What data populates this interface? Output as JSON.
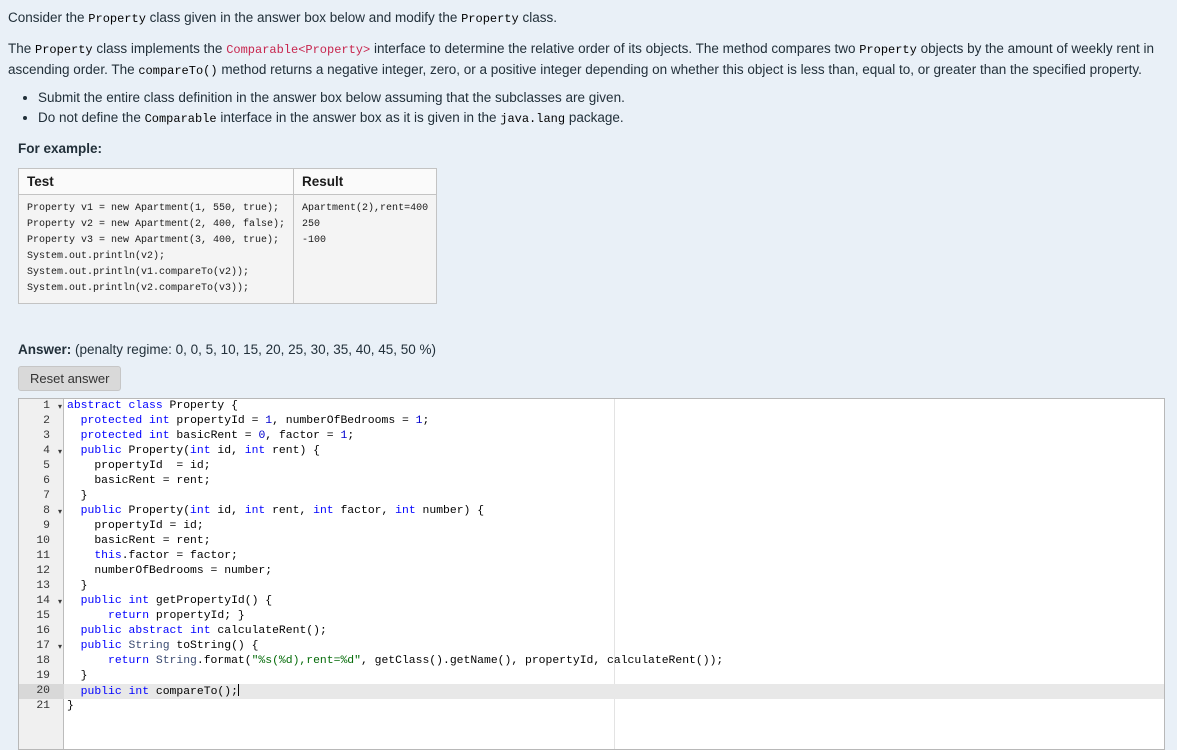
{
  "question": {
    "para1": [
      {
        "t": "text",
        "s": "Consider the "
      },
      {
        "t": "code",
        "s": "Property"
      },
      {
        "t": "text",
        "s": " class given in the answer box below and modify the "
      },
      {
        "t": "code",
        "s": "Property"
      },
      {
        "t": "text",
        "s": " class."
      }
    ],
    "para2": [
      {
        "t": "text",
        "s": "The "
      },
      {
        "t": "code",
        "s": "Property"
      },
      {
        "t": "text",
        "s": " class implements the "
      },
      {
        "t": "code_pink",
        "s": "Comparable<Property>"
      },
      {
        "t": "text",
        "s": " interface to determine the relative order of its objects. The method compares two "
      },
      {
        "t": "code",
        "s": "Property"
      },
      {
        "t": "text",
        "s": " objects by the amount of weekly rent in ascending order. The "
      },
      {
        "t": "code",
        "s": "compareTo()"
      },
      {
        "t": "text",
        "s": " method returns a negative integer, zero, or a positive integer depending on whether this object is less than, equal to, or greater than the specified property."
      }
    ],
    "bullets": [
      [
        {
          "t": "text",
          "s": "Submit the entire class definition in the answer box below assuming that the subclasses are given."
        }
      ],
      [
        {
          "t": "text",
          "s": "Do not define the "
        },
        {
          "t": "code",
          "s": "Comparable"
        },
        {
          "t": "text",
          "s": " interface in the answer box as it is given in the "
        },
        {
          "t": "code",
          "s": "java.lang"
        },
        {
          "t": "text",
          "s": " package."
        }
      ]
    ],
    "for_example_label": "For example:"
  },
  "example_table": {
    "test_header": "Test",
    "result_header": "Result",
    "test_code": "Property v1 = new Apartment(1, 550, true);\nProperty v2 = new Apartment(2, 400, false);\nProperty v3 = new Apartment(3, 400, true);\nSystem.out.println(v2);\nSystem.out.println(v1.compareTo(v2));\nSystem.out.println(v2.compareTo(v3));",
    "result_code": "Apartment(2),rent=400\n250\n-100"
  },
  "answer_section": {
    "label": "Answer:",
    "penalty_text": "(penalty regime: 0, 0, 5, 10, 15, 20, 25, 30, 35, 40, 45, 50 %)",
    "reset_button_label": "Reset answer"
  },
  "editor": {
    "active_line": 20,
    "fold_lines": [
      1,
      4,
      8,
      14,
      17
    ],
    "colors": {
      "keyword": "#0000ff",
      "number": "#0000cd",
      "string": "#036a07",
      "support_class": "#3c4c72",
      "plain": "#000000",
      "active_line_bg": "#e8e8e8",
      "gutter_bg": "#f0f0f0"
    },
    "lines": [
      [
        [
          "kw",
          "abstract"
        ],
        [
          "t",
          " "
        ],
        [
          "kw",
          "class"
        ],
        [
          "t",
          " Property {"
        ]
      ],
      [
        [
          "t",
          "  "
        ],
        [
          "kw",
          "protected"
        ],
        [
          "t",
          " "
        ],
        [
          "kw",
          "int"
        ],
        [
          "t",
          " propertyId = "
        ],
        [
          "num",
          "1"
        ],
        [
          "t",
          ", numberOfBedrooms = "
        ],
        [
          "num",
          "1"
        ],
        [
          "t",
          ";"
        ]
      ],
      [
        [
          "t",
          "  "
        ],
        [
          "kw",
          "protected"
        ],
        [
          "t",
          " "
        ],
        [
          "kw",
          "int"
        ],
        [
          "t",
          " basicRent = "
        ],
        [
          "num",
          "0"
        ],
        [
          "t",
          ", factor = "
        ],
        [
          "num",
          "1"
        ],
        [
          "t",
          ";"
        ]
      ],
      [
        [
          "t",
          "  "
        ],
        [
          "kw",
          "public"
        ],
        [
          "t",
          " Property("
        ],
        [
          "kw",
          "int"
        ],
        [
          "t",
          " id, "
        ],
        [
          "kw",
          "int"
        ],
        [
          "t",
          " rent) {"
        ]
      ],
      [
        [
          "t",
          "    propertyId  = id;"
        ]
      ],
      [
        [
          "t",
          "    basicRent = rent;"
        ]
      ],
      [
        [
          "t",
          "  }"
        ]
      ],
      [
        [
          "t",
          "  "
        ],
        [
          "kw",
          "public"
        ],
        [
          "t",
          " Property("
        ],
        [
          "kw",
          "int"
        ],
        [
          "t",
          " id, "
        ],
        [
          "kw",
          "int"
        ],
        [
          "t",
          " rent, "
        ],
        [
          "kw",
          "int"
        ],
        [
          "t",
          " factor, "
        ],
        [
          "kw",
          "int"
        ],
        [
          "t",
          " number) {"
        ]
      ],
      [
        [
          "t",
          "    propertyId = id;"
        ]
      ],
      [
        [
          "t",
          "    basicRent = rent;"
        ]
      ],
      [
        [
          "t",
          "    "
        ],
        [
          "kw",
          "this"
        ],
        [
          "t",
          ".factor = factor;"
        ]
      ],
      [
        [
          "t",
          "    numberOfBedrooms = number;"
        ]
      ],
      [
        [
          "t",
          "  }"
        ]
      ],
      [
        [
          "t",
          "  "
        ],
        [
          "kw",
          "public"
        ],
        [
          "t",
          " "
        ],
        [
          "kw",
          "int"
        ],
        [
          "t",
          " getPropertyId() {"
        ]
      ],
      [
        [
          "t",
          "      "
        ],
        [
          "kw",
          "return"
        ],
        [
          "t",
          " propertyId; }"
        ]
      ],
      [
        [
          "t",
          "  "
        ],
        [
          "kw",
          "public"
        ],
        [
          "t",
          " "
        ],
        [
          "kw",
          "abstract"
        ],
        [
          "t",
          " "
        ],
        [
          "kw",
          "int"
        ],
        [
          "t",
          " calculateRent();"
        ]
      ],
      [
        [
          "t",
          "  "
        ],
        [
          "kw",
          "public"
        ],
        [
          "t",
          " "
        ],
        [
          "sup",
          "String"
        ],
        [
          "t",
          " toString() {"
        ]
      ],
      [
        [
          "t",
          "      "
        ],
        [
          "kw",
          "return"
        ],
        [
          "t",
          " "
        ],
        [
          "sup",
          "String"
        ],
        [
          "t",
          ".format("
        ],
        [
          "str",
          "\"%s(%d),rent=%d\""
        ],
        [
          "t",
          ", getClass().getName(), propertyId, calculateRent());"
        ]
      ],
      [
        [
          "t",
          "  }"
        ]
      ],
      [
        [
          "t",
          "  "
        ],
        [
          "kw",
          "public"
        ],
        [
          "t",
          " "
        ],
        [
          "kw",
          "int"
        ],
        [
          "t",
          " compareTo();"
        ]
      ],
      [
        [
          "t",
          "}"
        ]
      ]
    ]
  }
}
